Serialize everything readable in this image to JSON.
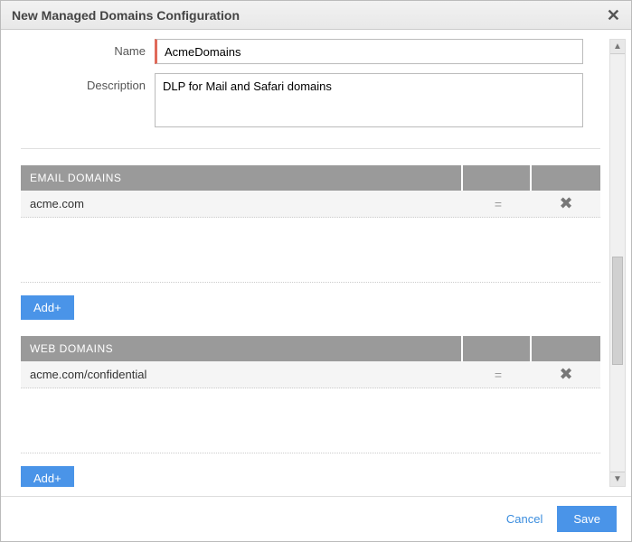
{
  "dialog": {
    "title": "New Managed Domains Configuration"
  },
  "form": {
    "nameLabel": "Name",
    "nameValue": "AcmeDomains",
    "descLabel": "Description",
    "descValue": "DLP for Mail and Safari domains"
  },
  "emailSection": {
    "header": "EMAIL DOMAINS",
    "rows": [
      {
        "domain": "acme.com"
      }
    ],
    "addLabel": "Add+"
  },
  "webSection": {
    "header": "WEB DOMAINS",
    "rows": [
      {
        "domain": "acme.com/confidential"
      }
    ],
    "addLabel": "Add+"
  },
  "footer": {
    "cancel": "Cancel",
    "save": "Save"
  },
  "icons": {
    "close": "✕",
    "drag": "=",
    "delete": "✖",
    "up": "▲",
    "down": "▼"
  }
}
